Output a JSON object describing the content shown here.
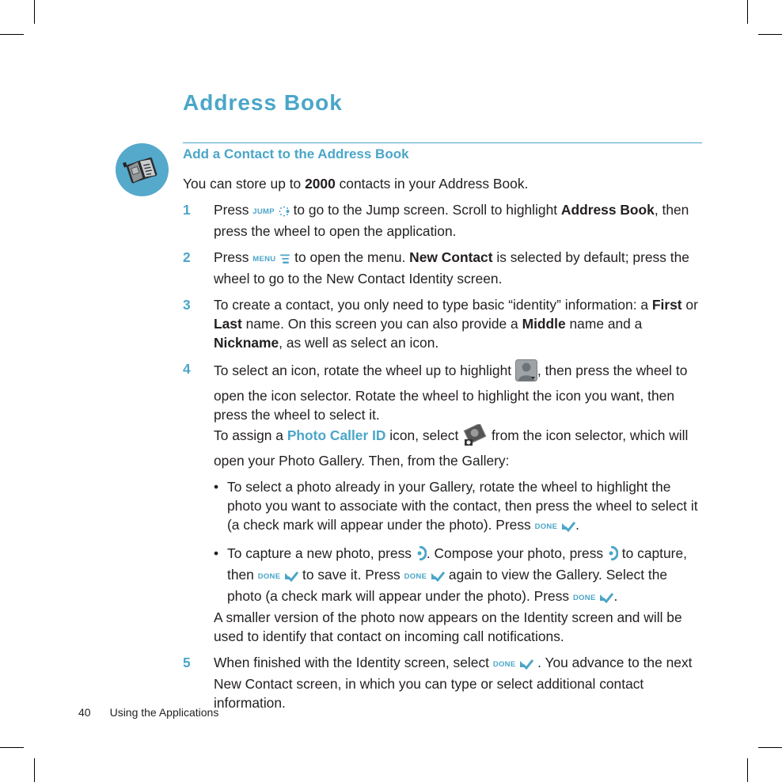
{
  "page": {
    "title": "Address Book",
    "section_title": "Add a Contact to the Address Book",
    "intro": {
      "pre": "You can store up to ",
      "bold": "2000",
      "post": " contacts in your Address Book."
    },
    "keys": {
      "jump": "JUMP",
      "menu": "MENU",
      "done": "DONE"
    },
    "steps": [
      {
        "num": "1",
        "t1": "Press ",
        "t2": " to go to the Jump screen. Scroll to highlight ",
        "b1": "Address Book",
        "t3": ", then press the wheel to open the application."
      },
      {
        "num": "2",
        "t1": "Press ",
        "t2": " to open the menu. ",
        "b1": "New Contact",
        "t3": " is selected by default; press the wheel to go to the New Contact Identity screen."
      },
      {
        "num": "3",
        "t1": "To create a contact, you only need to type basic “identity” information: a ",
        "b1": "First",
        "t2": " or ",
        "b2": "Last",
        "t3": " name. On this screen you can also provide a ",
        "b3": "Middle",
        "t4": " name and a ",
        "b4": "Nickname",
        "t5": ", as well as select an icon."
      },
      {
        "num": "4",
        "t1": "To select an icon, rotate the wheel up to highlight ",
        "t2": ", then press the wheel to open the icon selector. Rotate the wheel to highlight the icon you want, then press the wheel to select it.",
        "photo_pre": "To assign a ",
        "photo_link": "Photo Caller ID",
        "photo_mid": " icon, select ",
        "photo_post": " from the icon selector, which will open your Photo Gallery. Then, from the Gallery:",
        "bullets": [
          {
            "t1": "To select a photo already in your Gallery, rotate the wheel to highlight the photo you want to associate with the contact, then press the wheel to select it (a check mark will appear under the photo). Press ",
            "t2": "."
          },
          {
            "t1": "To capture a new photo, press ",
            "t2": ". Compose your photo, press ",
            "t3": " to capture, then ",
            "t4": " to save it. Press ",
            "t5": " again to view the Gallery. Select the photo (a check mark will appear under the photo). Press ",
            "t6": "."
          }
        ],
        "after": "A smaller version of the photo now appears on the Identity screen and will be used to identify that contact on incoming call notifications."
      },
      {
        "num": "5",
        "t1": "When finished with the Identity screen, select ",
        "t2": " . You advance to the next New Contact screen, in which you can type or select additional contact information."
      }
    ],
    "footer": {
      "page_number": "40",
      "section": "Using the Applications"
    },
    "icons": [
      "address-book-icon",
      "jump-icon",
      "menu-icon",
      "contact-silhouette-icon",
      "photo-caller-id-icon",
      "done-check-icon",
      "camera-shutter-icon"
    ],
    "colors": {
      "accent": "#4aa6c8",
      "text": "#231f20"
    }
  }
}
